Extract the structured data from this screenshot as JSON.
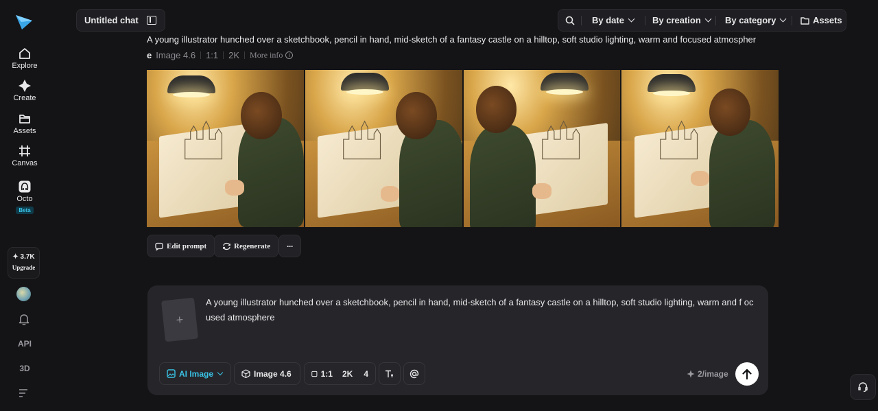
{
  "sidebar": {
    "logo_icon": "paper-plane-logo",
    "items": [
      {
        "label": "Explore",
        "icon": "home-icon"
      },
      {
        "label": "Create",
        "icon": "sparkle-icon"
      },
      {
        "label": "Assets",
        "icon": "folder-icon"
      },
      {
        "label": "Canvas",
        "icon": "canvas-icon"
      },
      {
        "label": "Octo",
        "icon": "octo-icon",
        "badge": "Beta"
      }
    ],
    "upgrade": {
      "credits": "✦ 3.7K",
      "label": "Upgrade"
    },
    "bottom": [
      "API",
      "3D"
    ]
  },
  "header": {
    "chat_title": "Untitled chat",
    "filters": {
      "by_date": "By date",
      "by_creation": "By creation",
      "by_category": "By category",
      "assets": "Assets"
    }
  },
  "result": {
    "prompt": "A young illustrator hunched over a sketchbook, pencil in hand, mid-sketch of a fantasy castle on a hilltop, soft studio lighting, warm and focused atmospher",
    "prompt_tail": "e",
    "model": "Image 4.6",
    "ratio": "1:1",
    "resolution": "2K",
    "more_info": "More info",
    "image_count": 4,
    "actions": {
      "edit": "Edit prompt",
      "regenerate": "Regenerate",
      "more": "···"
    }
  },
  "composer": {
    "add_placeholder": "+",
    "text": "A young illustrator hunched over a sketchbook, pencil in hand, mid-sketch of a fantasy castle on a hilltop, soft studio lighting, warm and f ocused atmosphere",
    "mode": "AI Image",
    "model": "Image 4.6",
    "ratio": "1:1",
    "resolution": "2K",
    "count": "4",
    "cost": "2/image",
    "accent": "#39c3e6"
  }
}
